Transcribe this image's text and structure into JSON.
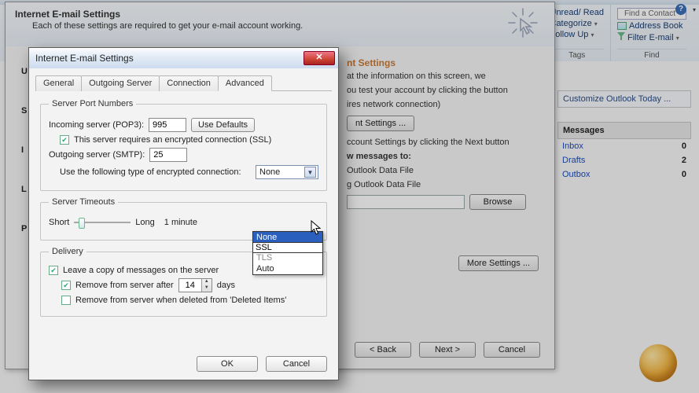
{
  "ribbon": {
    "tags_group": "Tags",
    "find_group": "Find",
    "unread_read": "Unread/ Read",
    "categorize": "Categorize",
    "follow_up": "Follow Up",
    "find_contact_placeholder": "Find a Contact",
    "address_book": "Address Book",
    "filter_email": "Filter E-mail"
  },
  "today": {
    "heading": "Customize Outlook Today ...",
    "messages": "Messages",
    "rows": [
      {
        "name": "Inbox",
        "count": "0"
      },
      {
        "name": "Drafts",
        "count": "2"
      },
      {
        "name": "Outbox",
        "count": "0"
      }
    ]
  },
  "acct": {
    "title": "Internet E-mail Settings",
    "subtitle": "Each of these settings are required to get your e-mail account working.",
    "user_info": "U",
    "test_heading": "nt Settings",
    "test_p1": "at the information on this screen, we",
    "test_p2": "ou test your account by clicking the button",
    "test_p3": "ires network connection)",
    "test_btn": "nt Settings ...",
    "test_p4": "ccount Settings by clicking the Next button",
    "deliver_head": "w messages to:",
    "deliver_opt1": "Outlook Data File",
    "deliver_opt2": "g Outlook Data File",
    "browse": "Browse",
    "more_settings": "More Settings ...",
    "back": "< Back",
    "next": "Next >",
    "cancel": "Cancel",
    "server_label_s": "S",
    "server_label_i": "I",
    "server_label_l": "L",
    "server_label_p": "P"
  },
  "front": {
    "title": "Internet E-mail Settings",
    "tabs": {
      "general": "General",
      "outgoing": "Outgoing Server",
      "connection": "Connection",
      "advanced": "Advanced"
    },
    "spn_legend": "Server Port Numbers",
    "incoming_label": "Incoming server (POP3):",
    "incoming_port": "995",
    "use_defaults": "Use Defaults",
    "ssl_check": "This server requires an encrypted connection (SSL)",
    "outgoing_label": "Outgoing server (SMTP):",
    "outgoing_port": "25",
    "enc_label": "Use the following type of encrypted connection:",
    "enc_value": "None",
    "enc_options": [
      "None",
      "SSL",
      "TLS",
      "Auto"
    ],
    "timeouts_legend": "Server Timeouts",
    "short": "Short",
    "long": "Long",
    "timeout": "1 minute",
    "delivery_legend": "Delivery",
    "leave_copy": "Leave a copy of messages on the server",
    "remove_after": "Remove from server after",
    "remove_days_value": "14",
    "days": "days",
    "remove_deleted": "Remove from server when deleted from 'Deleted Items'",
    "ok": "OK",
    "cancel": "Cancel"
  }
}
